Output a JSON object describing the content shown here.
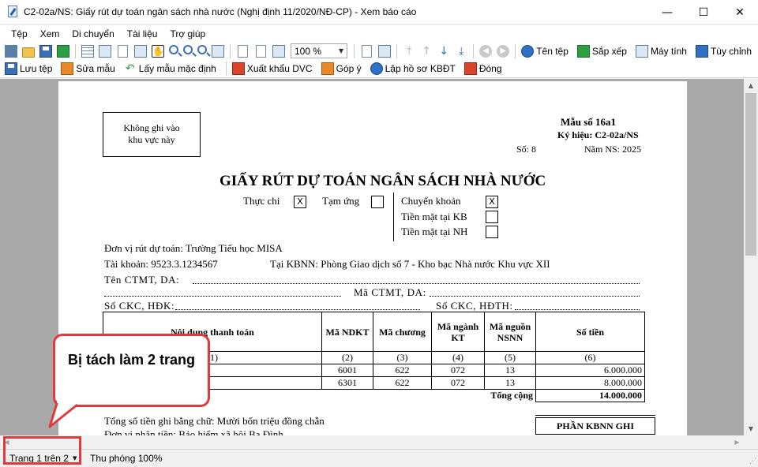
{
  "window": {
    "title": "C2-02a/NS: Giấy rút dự toán ngân sách nhà nước (Nghị định 11/2020/NĐ-CP) - Xem báo cáo",
    "minimize": "—",
    "maximize": "☐",
    "close": "✕"
  },
  "menu": [
    "Tệp",
    "Xem",
    "Di chuyển",
    "Tài liệu",
    "Trợ giúp"
  ],
  "toolbar": {
    "zoom_value": "100 %",
    "file_name_label": "Tên tệp",
    "sort_label": "Sắp xếp",
    "calculator_label": "Máy tính",
    "customize_label": "Tùy chỉnh",
    "save_file_label": "Lưu tệp",
    "edit_template_label": "Sửa mẫu",
    "default_template_label": "Lấy mẫu mặc định",
    "export_dvc_label": "Xuất khẩu DVC",
    "feedback_label": "Góp ý",
    "kbdt_label": "Lập hồ sơ KBĐT",
    "close_label": "Đóng"
  },
  "doc": {
    "no_write_area": [
      "Không ghi vào",
      "khu vực này"
    ],
    "form_no": "Mẫu số 16a1",
    "symbol": "Ký hiệu: C2-02a/NS",
    "number": "Số: 8",
    "budget_year": "Năm NS: 2025",
    "title": "GIẤY RÚT DỰ TOÁN NGÂN SÁCH NHÀ NƯỚC",
    "actual_spend": "Thực chi",
    "actual_spend_mark": "X",
    "advance": "Tạm ứng",
    "transfer": "Chuyển khoản",
    "transfer_mark": "X",
    "cash_kb": "Tiền mặt tại KB",
    "cash_nh": "Tiền mặt tại NH",
    "unit": "Đơn vị rút dự toán: Trường Tiểu học MISA",
    "account": "Tài khoản: 9523.3.1234567",
    "at_kbnn": "Tại KBNN: Phòng Giao dịch số 7 - Kho bạc Nhà nước Khu vực XII",
    "ctmt_name": "Tên CTMT, DA:",
    "ctmt_code": "Mã CTMT, DA:",
    "ckc": "Số CKC, HĐK:",
    "ckc_hdth": "Số CKC, HĐTH:",
    "table": {
      "headers": [
        "Nội dung thanh toán",
        "Mã NDKT",
        "Mã chương",
        "Mã ngành KT",
        "Mã nguồn NSNN",
        "Số tiền"
      ],
      "col_numbers": [
        "(1)",
        "(2)",
        "(3)",
        "(4)",
        "(5)",
        "(6)"
      ],
      "rows": [
        [
          "",
          "6001",
          "622",
          "072",
          "13",
          "6.000.000"
        ],
        [
          "",
          "6301",
          "622",
          "072",
          "13",
          "8.000.000"
        ]
      ],
      "total_label": "Tổng cộng",
      "total_value": "14.000.000"
    },
    "amount_in_words": "Tổng số tiền ghi bằng chữ: Mười bốn triệu đồng chẵn",
    "recipient": "Đơn vị nhận tiền: Bảo hiểm xã hội Ba Đình",
    "kbnn_box": "PHẦN KBNN GHI"
  },
  "callout": {
    "text": "Bị tách làm 2 trang"
  },
  "status": {
    "page_indicator": "Trang 1 trên 2",
    "zoom": "Thu phóng 100%"
  }
}
